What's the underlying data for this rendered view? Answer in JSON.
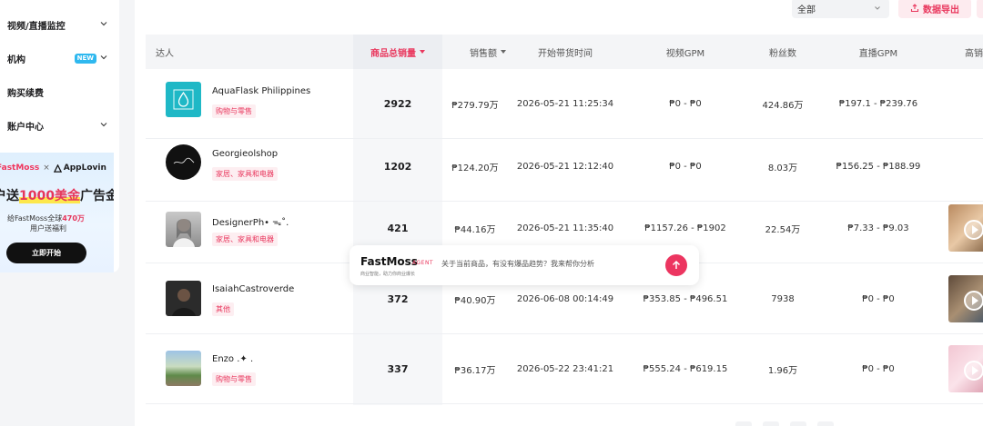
{
  "sidebar": {
    "items": [
      {
        "label": "视频/直播监控",
        "chevron": true,
        "badge": ""
      },
      {
        "label": "机构",
        "chevron": true,
        "badge": "NEW"
      },
      {
        "label": "购买续费",
        "chevron": false,
        "badge": ""
      },
      {
        "label": "账户中心",
        "chevron": true,
        "badge": ""
      }
    ],
    "promo": {
      "brand_a": "FastMoss",
      "brand_sep": "×",
      "brand_b": "AppLovin",
      "title_pre": "户送",
      "title_highlight": "1000美金",
      "title_post": "广告金",
      "sub_pre": "给FastMoss全球",
      "sub_highlight": "470万",
      "sub_line2": "用户送福利",
      "button": "立即开始"
    }
  },
  "toolbar": {
    "filter_value": "全部",
    "export_label": "数据导出"
  },
  "table": {
    "columns": [
      "达人",
      "商品总销量",
      "销售额",
      "开始带货时间",
      "视频GPM",
      "粉丝数",
      "直播GPM",
      "高销"
    ],
    "rows": [
      {
        "name": "AquaFlask Philippines",
        "tag": "购物与零售",
        "sold": "2922",
        "revenue": "₱279.79万",
        "start": "2026-05-21 11:25:34",
        "video_gpm": "₱0 - ₱0",
        "followers": "424.86万",
        "live_gpm": "₱197.1 - ₱239.76",
        "has_video": false
      },
      {
        "name": "Georgieolshop",
        "tag": "家居、家具和电器",
        "sold": "1202",
        "revenue": "₱124.20万",
        "start": "2026-05-21 12:12:40",
        "video_gpm": "₱0 - ₱0",
        "followers": "8.03万",
        "live_gpm": "₱156.25 - ₱188.99",
        "has_video": false
      },
      {
        "name": "DesignerPh• ᯓ˚.",
        "tag": "家居、家具和电器",
        "sold": "421",
        "revenue": "₱44.16万",
        "start": "2026-05-21 11:35:40",
        "video_gpm": "₱1157.26 - ₱1902",
        "followers": "22.54万",
        "live_gpm": "₱7.33 - ₱9.03",
        "has_video": true
      },
      {
        "name": "IsaiahCastroverde",
        "tag": "其他",
        "sold": "372",
        "revenue": "₱40.90万",
        "start": "2026-06-08 00:14:49",
        "video_gpm": "₱353.85 - ₱496.51",
        "followers": "7938",
        "live_gpm": "₱0 - ₱0",
        "has_video": true
      },
      {
        "name": "Enzo .✦ .",
        "tag": "购物与零售",
        "sold": "337",
        "revenue": "₱36.17万",
        "start": "2026-05-22 23:41:21",
        "video_gpm": "₱555.24 - ₱619.15",
        "followers": "1.96万",
        "live_gpm": "₱0 - ₱0",
        "has_video": true
      }
    ]
  },
  "agent": {
    "logo": "FastMoss",
    "badge": "AGENT",
    "tagline": "商业智能，助力你商业爆长",
    "prompt": "关于当前商品，有没有爆品趋势？我来帮你分析"
  },
  "colors": {
    "accent": "#e9385e",
    "new_badge": "#2fb8ef",
    "header_bg": "#f4f5f7"
  }
}
